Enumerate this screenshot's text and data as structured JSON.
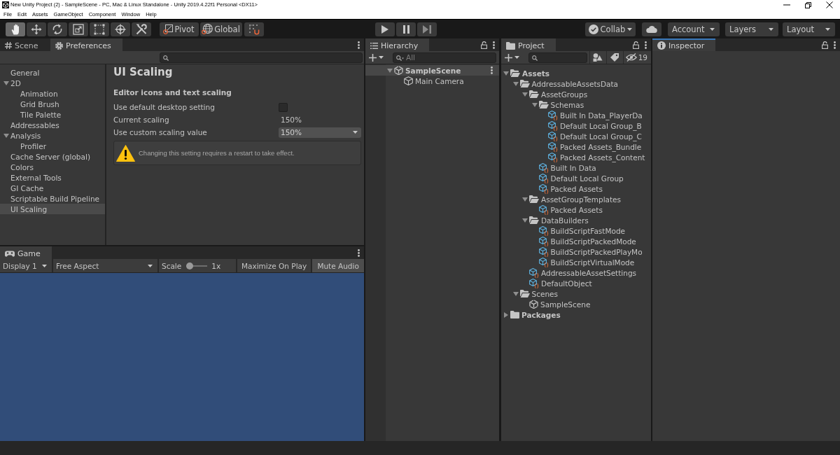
{
  "window": {
    "title": "New Unity Project (2) - SampleScene - PC, Mac & Linux Standalone - Unity 2019.4.22f1 Personal <DX11>"
  },
  "menu": [
    "File",
    "Edit",
    "Assets",
    "GameObject",
    "Component",
    "Window",
    "Help"
  ],
  "toolbar": {
    "tools": [
      {
        "selected": true
      },
      {
        "selected": false
      },
      {
        "selected": false
      },
      {
        "selected": false
      },
      {
        "selected": false
      },
      {
        "selected": false
      },
      {
        "selected": false
      }
    ],
    "pivot": "Pivot",
    "space": "Global",
    "collab": "Collab",
    "account": "Account",
    "layers": "Layers",
    "layout": "Layout"
  },
  "scene_dock": {
    "focused": false,
    "tabs": [
      {
        "label": "Scene",
        "selected": false
      },
      {
        "label": "Preferences",
        "selected": true
      }
    ],
    "preferences": {
      "sections": [
        {
          "label": "General",
          "selected": false
        },
        {
          "label": "2D",
          "selected": false,
          "expanded": true,
          "children": [
            {
              "label": "Animation",
              "selected": false
            },
            {
              "label": "Grid Brush",
              "selected": false
            },
            {
              "label": "Tile Palette",
              "selected": false
            }
          ]
        },
        {
          "label": "Addressables",
          "selected": false
        },
        {
          "label": "Analysis",
          "selected": false,
          "expanded": true,
          "children": [
            {
              "label": "Profiler",
              "selected": false
            }
          ]
        },
        {
          "label": "Cache Server (global)",
          "selected": false
        },
        {
          "label": "Colors",
          "selected": false
        },
        {
          "label": "External Tools",
          "selected": false
        },
        {
          "label": "GI Cache",
          "selected": false
        },
        {
          "label": "Scriptable Build Pipeline",
          "selected": false
        },
        {
          "label": "UI Scaling",
          "selected": true
        }
      ],
      "content": {
        "title": "UI Scaling",
        "section": "Editor icons and text scaling",
        "fields": [
          {
            "kind": "checkbox",
            "label": "Use default desktop setting",
            "checked": false
          },
          {
            "kind": "text",
            "label": "Current scaling",
            "value": "150%"
          },
          {
            "kind": "dropdown",
            "label": "Use custom scaling value",
            "value": "150%"
          }
        ],
        "help": {
          "kind": "warning",
          "text": "Changing this setting requires a restart to take effect."
        }
      }
    }
  },
  "game_dock": {
    "focused": false,
    "tabs": [
      {
        "label": "Game",
        "selected": true
      }
    ],
    "toolbar": {
      "display": "Display 1",
      "aspect": "Free Aspect",
      "scale": {
        "label": "Scale",
        "level": 0,
        "reading": "1x"
      },
      "buttons": [
        {
          "label": "Maximize On Play",
          "on": false
        },
        {
          "label": "Mute Audio",
          "on": true
        }
      ]
    }
  },
  "hierarchy": {
    "focused": false,
    "tabs": [
      {
        "label": "Hierarchy",
        "selected": true
      }
    ],
    "search": {
      "placeholder": "All"
    },
    "tree": [
      {
        "label": "SampleScene",
        "kind": "scene",
        "expanded": true,
        "selected": false,
        "children": [
          {
            "label": "Main Camera",
            "kind": "gameobject",
            "selected": false
          }
        ]
      }
    ]
  },
  "project": {
    "focused": false,
    "tabs": [
      {
        "label": "Project",
        "selected": true
      }
    ],
    "hidden_count": "19",
    "tree": [
      {
        "label": "Assets",
        "kind": "folder",
        "expanded": true,
        "selected": false,
        "children": [
          {
            "label": "AddressableAssetsData",
            "kind": "folder",
            "expanded": true,
            "selected": false,
            "children": [
              {
                "label": "AssetGroups",
                "kind": "folder",
                "expanded": true,
                "selected": false,
                "children": [
                  {
                    "label": "Schemas",
                    "kind": "folder",
                    "expanded": true,
                    "selected": false,
                    "children": [
                      {
                        "label": "Built In Data_PlayerDa",
                        "kind": "asset",
                        "selected": false
                      },
                      {
                        "label": "Default Local Group_B",
                        "kind": "asset",
                        "selected": false
                      },
                      {
                        "label": "Default Local Group_C",
                        "kind": "asset",
                        "selected": false
                      },
                      {
                        "label": "Packed Assets_Bundle",
                        "kind": "asset",
                        "selected": false
                      },
                      {
                        "label": "Packed Assets_Content",
                        "kind": "asset",
                        "selected": false
                      }
                    ]
                  },
                  {
                    "label": "Built In Data",
                    "kind": "asset",
                    "selected": false
                  },
                  {
                    "label": "Default Local Group",
                    "kind": "asset",
                    "selected": false
                  },
                  {
                    "label": "Packed Assets",
                    "kind": "asset",
                    "selected": false
                  }
                ]
              },
              {
                "label": "AssetGroupTemplates",
                "kind": "folder",
                "expanded": true,
                "selected": false,
                "children": [
                  {
                    "label": "Packed Assets",
                    "kind": "asset",
                    "selected": false
                  }
                ]
              },
              {
                "label": "DataBuilders",
                "kind": "folder",
                "expanded": true,
                "selected": false,
                "children": [
                  {
                    "label": "BuildScriptFastMode",
                    "kind": "asset",
                    "selected": false
                  },
                  {
                    "label": "BuildScriptPackedMode",
                    "kind": "asset",
                    "selected": false
                  },
                  {
                    "label": "BuildScriptPackedPlayMo",
                    "kind": "asset",
                    "selected": false
                  },
                  {
                    "label": "BuildScriptVirtualMode",
                    "kind": "asset",
                    "selected": false
                  }
                ]
              },
              {
                "label": "AddressableAssetSettings",
                "kind": "asset",
                "selected": false
              },
              {
                "label": "DefaultObject",
                "kind": "asset",
                "selected": false
              }
            ]
          },
          {
            "label": "Scenes",
            "kind": "folder",
            "expanded": true,
            "selected": false,
            "children": [
              {
                "label": "SampleScene",
                "kind": "scene",
                "selected": false
              }
            ]
          }
        ]
      },
      {
        "label": "Packages",
        "kind": "folder",
        "expanded": false,
        "selected": false
      }
    ]
  },
  "inspector": {
    "focused": true,
    "tabs": [
      {
        "label": "Inspector",
        "selected": true
      }
    ]
  }
}
